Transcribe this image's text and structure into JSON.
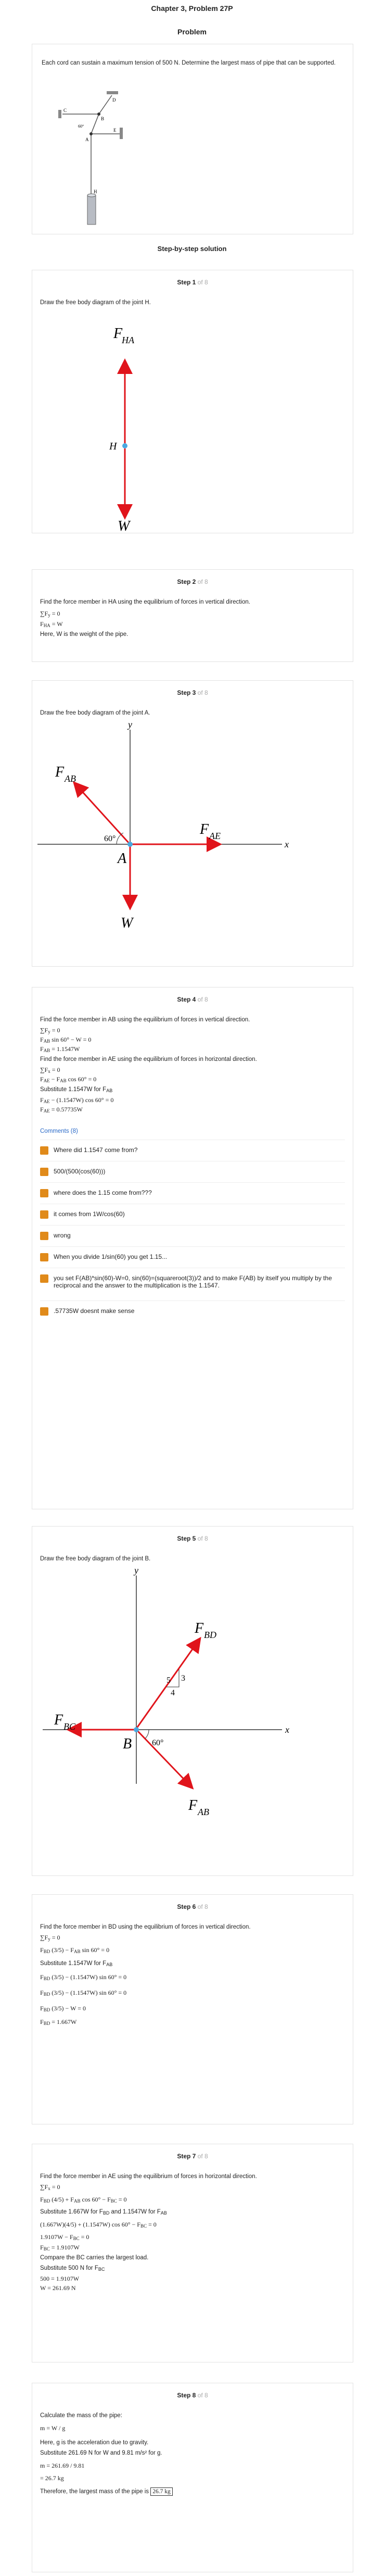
{
  "header": {
    "title": "Chapter 3, Problem 27P",
    "problem_label": "Problem"
  },
  "problem": {
    "text": "Each cord can sustain a maximum tension of 500 N. Determine the largest mass of pipe that can be supported."
  },
  "figure": {
    "labels": [
      "B",
      "A",
      "C",
      "D",
      "E",
      "H",
      "60°"
    ]
  },
  "solution_title": "Step-by-step solution",
  "steps": [
    {
      "label": "Step 1",
      "of": "of 8",
      "text": "Draw the free body diagram of the joint H.",
      "labels": [
        "F",
        "HA",
        "H",
        "W"
      ]
    },
    {
      "label": "Step 2",
      "of": "of 8",
      "text": "Find the force member in HA using the equilibrium of forces in vertical direction.",
      "eq1": "∑F",
      "eq1_sub": "y",
      "eq1_rest": " = 0",
      "eq2": "F",
      "eq2_sub": "HA",
      "eq2_rest": " = W",
      "note": "Here, W is the weight of the pipe."
    },
    {
      "label": "Step 3",
      "of": "of 8",
      "text": "Draw the free body diagram of the joint A.",
      "labels": {
        "y": "y",
        "x": "x",
        "fab": "F",
        "fab_sub": "AB",
        "fae": "F",
        "fae_sub": "AE",
        "a": "A",
        "w": "W",
        "angle": "60°"
      }
    },
    {
      "label": "Step 4",
      "of": "of 8",
      "text1": "Find the force member in AB using the equilibrium of forces in vertical direction.",
      "l1": "∑F",
      "l1s": "y",
      "l1r": " = 0",
      "l2": "F",
      "l2s": "AB",
      "l2r": " sin 60° − W = 0",
      "l3": "F",
      "l3s": "AB",
      "l3r": " = 1.1547W",
      "text2": "Find the force member in AE using the equilibrium of forces in horizontal direction.",
      "l4": "∑F",
      "l4s": "x",
      "l4r": " = 0",
      "l5": "F",
      "l5s": "AE",
      "l5r": " − F",
      "l5s2": "AB",
      "l5r2": " cos 60° = 0",
      "subst": "Substitute 1.1547W for F",
      "subst_s": "AB",
      "l6": "F",
      "l6s": "AE",
      "l6r": " − (1.1547W) cos 60° = 0",
      "l7": "F",
      "l7s": "AE",
      "l7r": " = 0.57735W"
    },
    {
      "label": "Step 5",
      "of": "of 8",
      "text": "Draw the free body diagram of the joint B.",
      "labels": {
        "y": "y",
        "x": "x",
        "fbd": "F",
        "fbd_sub": "BD",
        "fbc": "F",
        "fbc_sub": "BC",
        "fab": "F",
        "fab_sub": "AB",
        "b": "B",
        "five": "5",
        "three": "3",
        "four": "4",
        "angle": "60°"
      }
    },
    {
      "label": "Step 6",
      "of": "of 8",
      "text": "Find the force member in BD using the equilibrium of forces in vertical direction.",
      "l1": "∑F",
      "l1s": "y",
      "l1r": " = 0",
      "l2": "F",
      "l2s": "BD",
      "l2r": " (3/5) − F",
      "l2s2": "AB",
      "l2r2": " sin 60° = 0",
      "subst": "Substitute 1.1547W for F",
      "subst_s": "AB",
      "l3": "F",
      "l3s": "BD",
      "l3r": " (3/5) − (1.1547W) sin 60° = 0",
      "l4": "F",
      "l4s": "BD",
      "l4r": " (3/5) − (1.1547W) sin 60° = 0",
      "l5": "F",
      "l5s": "BD",
      "l5r": " (3/5) − W = 0",
      "l6": "F",
      "l6s": "BD",
      "l6r": " = 1.667W"
    },
    {
      "label": "Step 7",
      "of": "of 8",
      "text": "Find the force member in AE using the equilibrium of forces in horizontal direction.",
      "l1": "∑F",
      "l1s": "x",
      "l1r": " = 0",
      "l2": "F",
      "l2s": "BD",
      "l2r": " (4/5) + F",
      "l2s2": "AB",
      "l2r2": " cos 60° − F",
      "l2s3": "BC",
      "l2r3": " = 0",
      "subst": "Substitute 1.667W for F",
      "subst_s": "BD",
      "subst2": " and 1.1547W for F",
      "subst2_s": "AB",
      "l3": "(1.667W)(4/5) + (1.1547W) cos 60° − F",
      "l3s": "BC",
      "l3r": " = 0",
      "l4": "1.9107W − F",
      "l4s": "BC",
      "l4r": " = 0",
      "l5": "F",
      "l5s": "BC",
      "l5r": " = 1.9107W",
      "compare": "Compare the BC carries the largest load.",
      "subst3": "Substitute 500 N for F",
      "subst3_s": "BC",
      "l6": "500 = 1.9107W",
      "l7": "W = 261.69 N"
    },
    {
      "label": "Step 8",
      "of": "of 8",
      "text": "Calculate the mass of the pipe:",
      "l1": "m = W / g",
      "note": "Here, g is the acceleration due to gravity.",
      "subst": "Substitute 261.69 N for W and 9.81 m/s² for g.",
      "l2": "m = 261.69 / 9.81",
      "l3": "= 26.7 kg",
      "final": "Therefore, the largest mass of the pipe is",
      "answer": "26.7 kg"
    }
  ],
  "comments": {
    "label": "Comments (8)",
    "items": [
      "Where did 1.1547 come from?",
      "500/(500(cos(60)))",
      "where does the 1.15 come from???",
      "it comes from 1W/cos(60)",
      "wrong",
      "When you divide 1/sin(60) you get 1.15...",
      "you set F(AB)*sin(60)-W=0, sin(60)=(squareroot(3))/2 and to make F(AB) by itself you multiply by the reciprocal and the answer to the multiplication is the 1.1547.",
      ".57735W doesnt make sense"
    ]
  },
  "colors": {
    "arrow": "#e0141b",
    "node": "#4aa8e0",
    "avatar": "#e08a1a",
    "link": "#2a6ac8"
  }
}
